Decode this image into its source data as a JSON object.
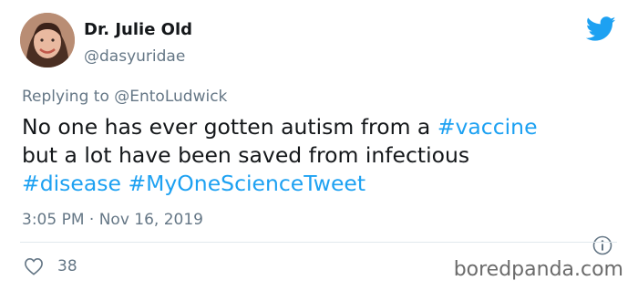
{
  "author": {
    "name": "Dr. Julie Old",
    "handle": "@dasyuridae"
  },
  "reply": {
    "prefix": "Replying to",
    "mention": "@EntoLudwick"
  },
  "tweet": {
    "part1": "No one has ever gotten autism from a ",
    "tag1": "#vaccine",
    "part2": " but a lot have been saved from infectious ",
    "tag2": "#disease",
    "part3": " ",
    "tag3": "#MyOneScienceTweet"
  },
  "timestamp": "3:05 PM · Nov 16, 2019",
  "likes": "38",
  "watermark": "boredpanda.com",
  "colors": {
    "link": "#1da1f2",
    "muted": "#657786",
    "text": "#14171a"
  },
  "icons": {
    "brand": "twitter-bird-icon",
    "info": "info-icon",
    "like": "heart-icon"
  }
}
